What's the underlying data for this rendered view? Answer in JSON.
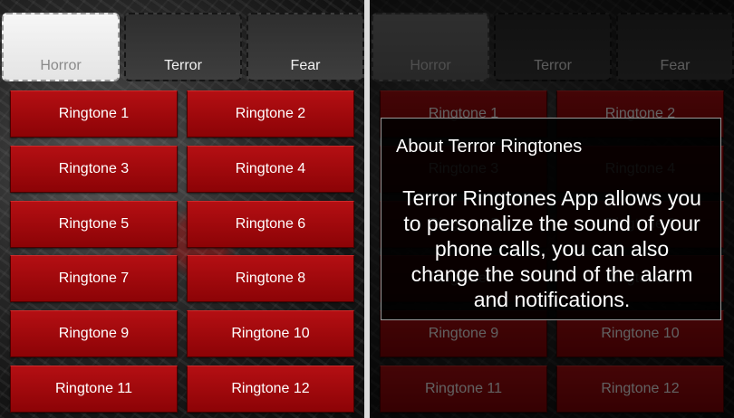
{
  "tabs": [
    "Horror",
    "Terror",
    "Fear"
  ],
  "active_tab": "Horror",
  "ringtones": [
    "Ringtone 1",
    "Ringtone 2",
    "Ringtone 3",
    "Ringtone 4",
    "Ringtone 5",
    "Ringtone 6",
    "Ringtone 7",
    "Ringtone 8",
    "Ringtone 9",
    "Ringtone 10",
    "Ringtone 11",
    "Ringtone 12"
  ],
  "dialog": {
    "title": "About Terror Ringtones",
    "body_lines": [
      "Terror Ringtones App allows you",
      "to personalize the sound of your",
      "phone calls, you can also",
      "change the sound of the alarm",
      "and notifications."
    ]
  },
  "colors": {
    "button_red": "#a0080c",
    "active_tab": "#efefef"
  }
}
